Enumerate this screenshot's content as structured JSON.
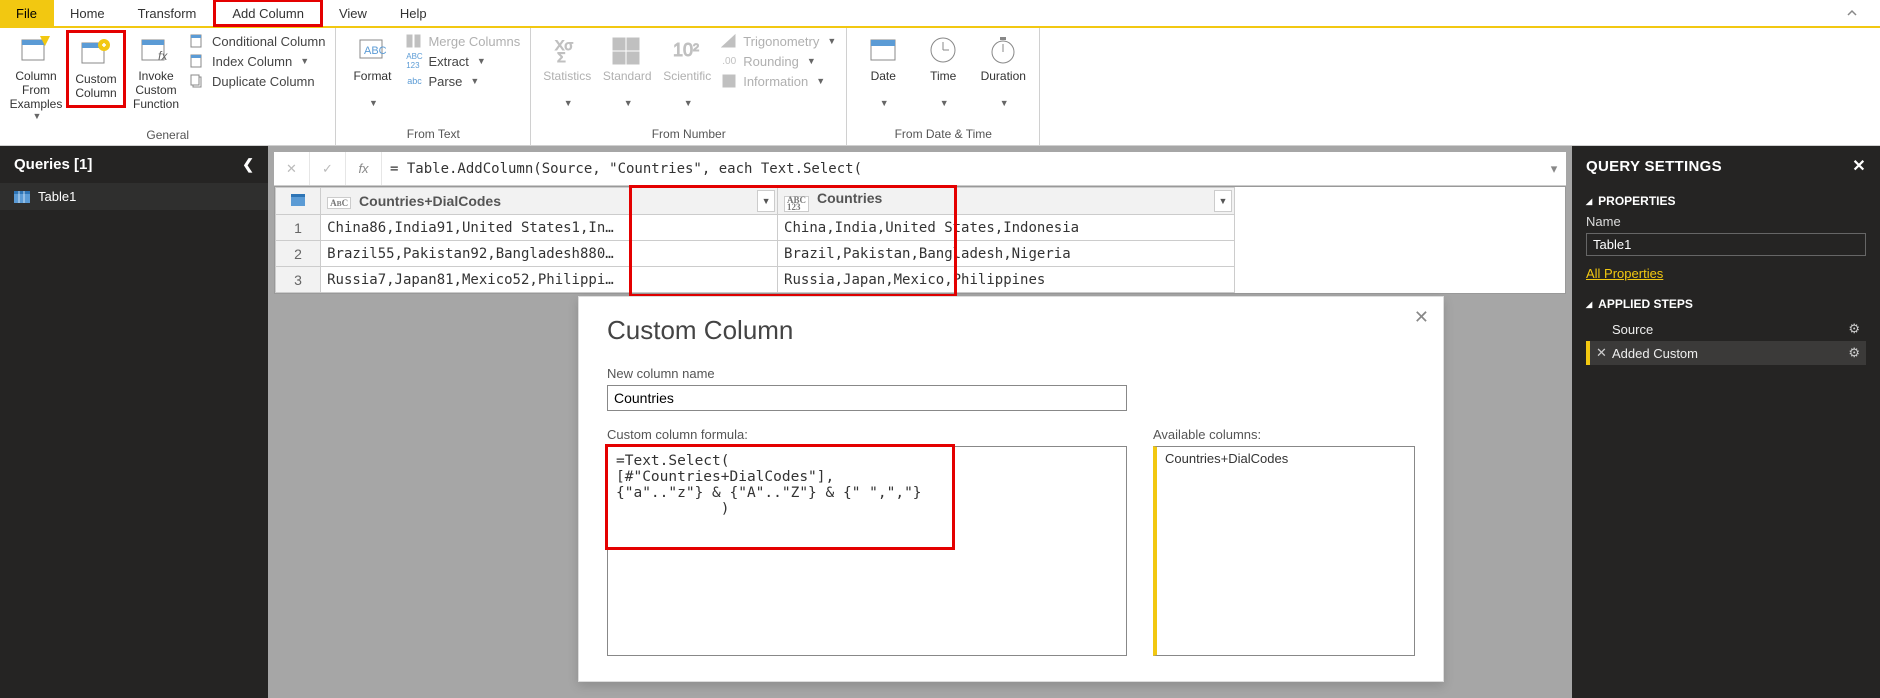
{
  "tabs": {
    "file": "File",
    "home": "Home",
    "transform": "Transform",
    "addcolumn": "Add Column",
    "view": "View",
    "help": "Help"
  },
  "ribbon": {
    "general": {
      "label": "General",
      "column_from_examples": "Column From\nExamples",
      "custom_column": "Custom\nColumn",
      "invoke_custom_function": "Invoke Custom\nFunction",
      "conditional_column": "Conditional Column",
      "index_column": "Index Column",
      "duplicate_column": "Duplicate Column"
    },
    "from_text": {
      "label": "From Text",
      "format": "Format",
      "merge_columns": "Merge Columns",
      "extract": "Extract",
      "parse": "Parse"
    },
    "from_number": {
      "label": "From Number",
      "statistics": "Statistics",
      "standard": "Standard",
      "scientific": "Scientific",
      "trigonometry": "Trigonometry",
      "rounding": "Rounding",
      "information": "Information"
    },
    "from_datetime": {
      "label": "From Date & Time",
      "date": "Date",
      "time": "Time",
      "duration": "Duration"
    }
  },
  "queries": {
    "header": "Queries [1]",
    "items": [
      "Table1"
    ]
  },
  "formula_bar": "= Table.AddColumn(Source, \"Countries\", each Text.Select(",
  "grid": {
    "col1": {
      "name": "Countries+DialCodes",
      "type": "ABC"
    },
    "col2": {
      "name": "Countries",
      "type": "ABC123"
    },
    "rows": [
      {
        "n": "1",
        "a": "China86,India91,United States1,In…",
        "b": "China,India,United States,Indonesia"
      },
      {
        "n": "2",
        "a": "Brazil55,Pakistan92,Bangladesh880…",
        "b": "Brazil,Pakistan,Bangladesh,Nigeria"
      },
      {
        "n": "3",
        "a": "Russia7,Japan81,Mexico52,Philippi…",
        "b": "Russia,Japan,Mexico,Philippines"
      }
    ]
  },
  "dialog": {
    "title": "Custom Column",
    "new_col_label": "New column name",
    "new_col_value": "Countries",
    "formula_label": "Custom column formula:",
    "formula_text": "=Text.Select(\n[#\"Countries+DialCodes\"],\n{\"a\"..\"z\"} & {\"A\"..\"Z\"} & {\" \",\",\"}\n            )",
    "available_label": "Available columns:",
    "available_items": [
      "Countries+DialCodes"
    ]
  },
  "query_settings": {
    "header": "QUERY SETTINGS",
    "properties": "PROPERTIES",
    "name_label": "Name",
    "name_value": "Table1",
    "all_props": "All Properties",
    "applied_steps_label": "APPLIED STEPS",
    "steps": [
      {
        "name": "Source",
        "gear": true,
        "sel": false
      },
      {
        "name": "Added Custom",
        "gear": true,
        "sel": true
      }
    ]
  }
}
